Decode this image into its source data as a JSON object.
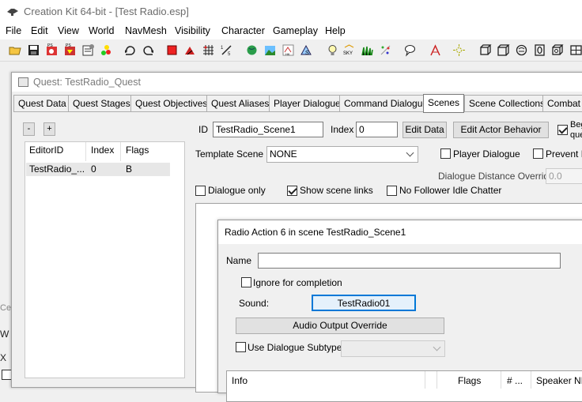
{
  "app": {
    "title": "Creation Kit 64-bit - [Test Radio.esp]"
  },
  "menu": [
    "File",
    "Edit",
    "View",
    "World",
    "NavMesh",
    "Visibility",
    "Character",
    "Gameplay",
    "Help"
  ],
  "toolbar_icons": [
    "open-folder-icon",
    "save-icon",
    "preferences-icon",
    "save-plugin-icon",
    "object-window-icon",
    "color-tool-icon",
    "undo-icon",
    "redo-icon",
    "render-window-icon",
    "terrain-icon",
    "grid-icon",
    "snap-icon",
    "globe-icon",
    "landscape-icon",
    "havok-icon",
    "navmesh-icon",
    "light-icon",
    "sky-icon",
    "grass-icon",
    "particles-icon",
    "speech-icon",
    "marker-icon",
    "fog-icon",
    "cube-icon",
    "box-icon",
    "sphere-icon",
    "zero-icon",
    "cube-outline-icon",
    "rectangle-icon"
  ],
  "background_window": {
    "title_fragment": "Ce",
    "line1": "W",
    "line2": "X"
  },
  "quest": {
    "title": "Quest: TestRadio_Quest",
    "tabs": [
      "Quest Data",
      "Quest Stages",
      "Quest Objectives",
      "Quest Aliases",
      "Player Dialogue",
      "Command Dialogue",
      "Scenes",
      "Scene Collections",
      "Combat"
    ],
    "active_tab": "Scenes",
    "minus_label": "-",
    "plus_label": "+",
    "list": {
      "columns": [
        "EditorID",
        "Index",
        "Flags"
      ],
      "rows": [
        {
          "editor_id": "TestRadio_...",
          "index": "0",
          "flags": "B"
        }
      ]
    },
    "scene": {
      "id_label": "ID",
      "id_value": "TestRadio_Scene1",
      "index_label": "Index",
      "index_value": "0",
      "edit_data_label": "Edit Data",
      "edit_actor_label": "Edit Actor Behavior",
      "begin_label_1": "Beg",
      "begin_label_2": "que",
      "template_label": "Template Scene",
      "template_value": "NONE",
      "player_dialogue_label": "Player Dialogue",
      "prevent_label": "Prevent F",
      "distance_label": "Dialogue Distance Override",
      "distance_value": "0.0",
      "dialogue_only_label": "Dialogue only",
      "show_links_label": "Show scene links",
      "no_follower_label": "No Follower Idle Chatter"
    }
  },
  "radio_dialog": {
    "title": "Radio Action 6 in scene TestRadio_Scene1",
    "name_label": "Name",
    "name_value": "",
    "ignore_label": "Ignore for completion",
    "sound_label": "Sound:",
    "sound_button": "TestRadio01",
    "audio_override": "Audio Output Override",
    "use_subtype_label": "Use Dialogue Subtype",
    "info_columns": [
      "Info",
      "Flags",
      "# ...",
      "Speaker NPC"
    ]
  }
}
